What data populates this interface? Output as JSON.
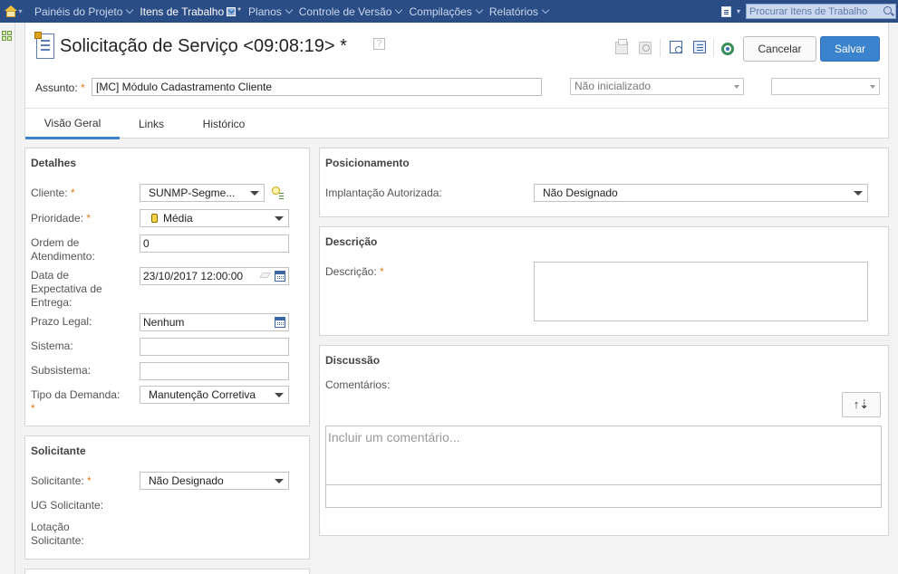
{
  "nav": {
    "items": [
      {
        "label": "Painéis do Projeto"
      },
      {
        "label": "Itens de Trabalho"
      },
      {
        "label": "Planos"
      },
      {
        "label": "Controle de Versão"
      },
      {
        "label": "Compilações"
      },
      {
        "label": "Relatórios"
      }
    ],
    "star": "*",
    "search_placeholder": "Procurar Itens de Trabalho"
  },
  "header": {
    "title": "Solicitação de Serviço <09:08:19> *",
    "help": "?",
    "cancel_label": "Cancelar",
    "save_label": "Salvar",
    "subject_label": "Assunto:",
    "subject_value": "[MC]  Módulo Cadastramento Cliente",
    "status_value": "Não inicializado",
    "secondary_value": "",
    "required_mark": "*"
  },
  "tabs": [
    {
      "label": "Visão Geral"
    },
    {
      "label": "Links"
    },
    {
      "label": "Histórico"
    }
  ],
  "details": {
    "title": "Detalhes",
    "cliente_label": "Cliente:",
    "cliente_value": "SUNMP-Segme...",
    "prioridade_label": "Prioridade:",
    "prioridade_value": "Média",
    "ordem_label_1": "Ordem de",
    "ordem_label_2": "Atendimento:",
    "ordem_value": "0",
    "data_label_1": "Data de",
    "data_label_2": "Expectativa de",
    "data_label_3": "Entrega:",
    "data_value": "23/10/2017 12:00:00",
    "prazo_label": "Prazo Legal:",
    "prazo_value": "Nenhum",
    "sistema_label": "Sistema:",
    "sistema_value": "",
    "subsistema_label": "Subsistema:",
    "subsistema_value": "",
    "tipo_label": "Tipo da Demanda:",
    "tipo_value": "Manutenção Corretiva"
  },
  "requester": {
    "title": "Solicitante",
    "solicitante_label": "Solicitante:",
    "solicitante_value": "Não Designado",
    "ug_label": "UG Solicitante:",
    "lotacao_label_1": "Lotação",
    "lotacao_label_2": "Solicitante:"
  },
  "positioning": {
    "title": "Posicionamento",
    "implantacao_label": "Implantação Autorizada:",
    "implantacao_value": "Não Designado"
  },
  "description": {
    "title": "Descrição",
    "label": "Descrição:"
  },
  "discussion": {
    "title": "Discussão",
    "comments_label": "Comentários:",
    "sort_label": "↑⇣",
    "comment_placeholder": "Incluir um comentário..."
  },
  "icons": {
    "home": "home-icon",
    "search": "search-icon",
    "calendar": "calendar-icon"
  },
  "colors": {
    "nav_bg": "#2b4d85",
    "accent": "#3b83cc",
    "required": "#e07b1a"
  }
}
